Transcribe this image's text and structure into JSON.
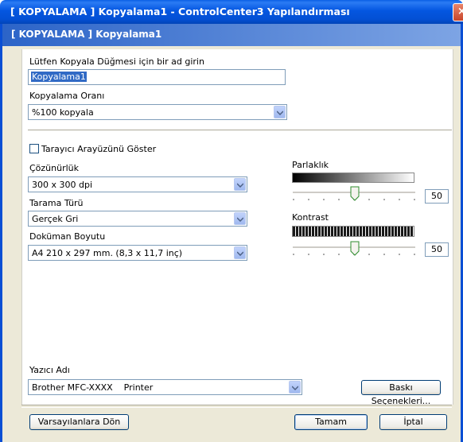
{
  "window": {
    "title": "[ KOPYALAMA ]  Kopyalama1 - ControlCenter3 Yapılandırması",
    "close_glyph": "×"
  },
  "banner": {
    "text": "[ KOPYALAMA ]  Kopyalama1"
  },
  "name_section": {
    "label": "Lütfen Kopyala Düğmesi için bir ad girin",
    "value": "Kopyalama1"
  },
  "copy_ratio": {
    "label": "Kopyalama Oranı",
    "value": "%100 kopyala"
  },
  "scanner_ui": {
    "label": "Tarayıcı Arayüzünü Göster",
    "checked": false
  },
  "resolution": {
    "label": "Çözünürlük",
    "value": "300 x 300 dpi"
  },
  "scan_type": {
    "label": "Tarama Türü",
    "value": "Gerçek Gri"
  },
  "doc_size": {
    "label": "Doküman Boyutu",
    "value": "A4 210 x 297 mm. (8,3 x 11,7 inç)"
  },
  "brightness": {
    "label": "Parlaklık",
    "value": "50",
    "level": 0.5
  },
  "contrast": {
    "label": "Kontrast",
    "value": "50",
    "level": 0.5
  },
  "printer": {
    "label": "Yazıcı Adı",
    "value": "Brother MFC-XXXX    Printer",
    "options_button": "Baskı Seçenekleri..."
  },
  "footer": {
    "defaults_button": "Varsayılanlara Dön",
    "ok_button": "Tamam",
    "cancel_button": "İptal"
  }
}
